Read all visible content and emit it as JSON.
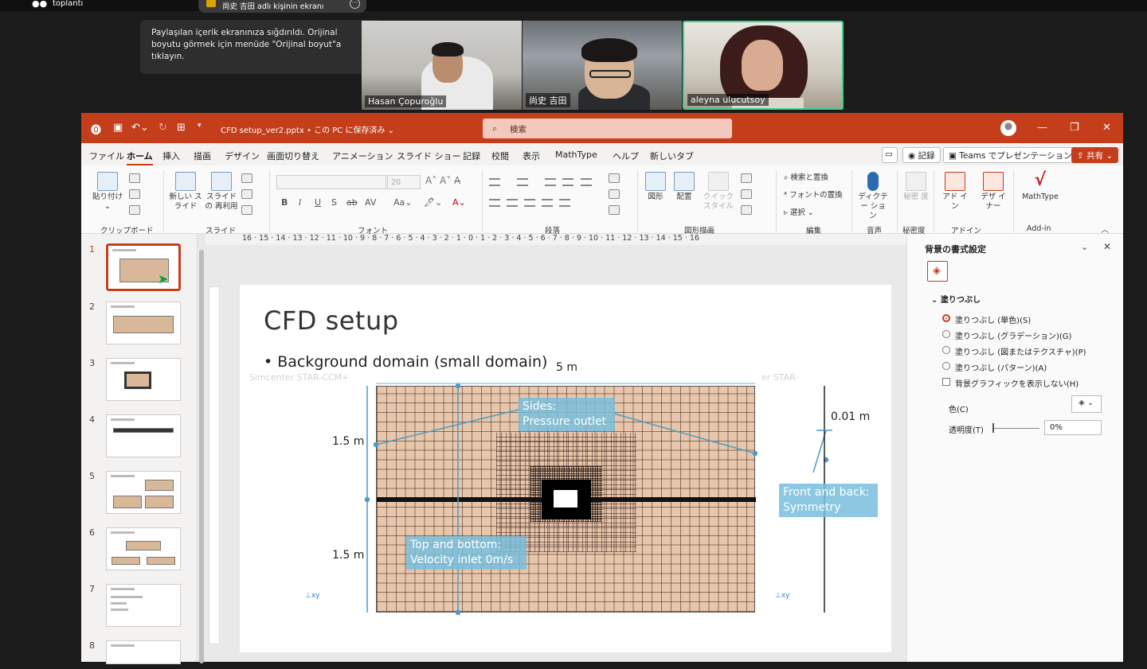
{
  "meeting": {
    "label": "toplantı",
    "sharer_chip": "尚史 吉田 adlı kişinin ekranı",
    "tooltip": "Paylaşılan içerik ekranınıza sığdırıldı. Orijinal boyutu görmek için menüde \"Orijinal boyut\"a tıklayın.",
    "participants": [
      {
        "name": "Hasan Çopuroğlu"
      },
      {
        "name": "尚史 吉田"
      },
      {
        "name": "aleyna ulucutsoy"
      }
    ]
  },
  "powerpoint": {
    "filename": "CFD setup_ver2.pptx • この PC に保存済み ⌄",
    "search_placeholder": "検索",
    "menu": [
      "ファイル",
      "ホーム",
      "挿入",
      "描画",
      "デザイン",
      "画面切り替え",
      "アニメーション",
      "スライド ショー",
      "記録",
      "校閲",
      "表示",
      "MathType",
      "ヘルプ",
      "新しいタブ"
    ],
    "record_btn": "記録",
    "teams_btn": "Teams でプレゼンテーション",
    "share_btn": "共有",
    "ribbon": {
      "paste": "貼り付け",
      "new_slide": "新しい スライド",
      "reuse": "スライドの 再利用",
      "font_size": "20",
      "shapes": "図形",
      "arrange": "配置",
      "quick_styles": "クイック スタイル",
      "find_replace": "検索と置換",
      "font_replace": "フォントの置換",
      "select": "選択",
      "dictate": "ディクテー ション",
      "sensitivity": "秘密 度",
      "addins": "アド イン",
      "designer": "デザ イナー",
      "mathtype": "MathType",
      "groups": [
        "クリップボード",
        "スライド",
        "フォント",
        "段落",
        "図形描画",
        "編集",
        "音声",
        "秘密度",
        "アドイン",
        "Add-in"
      ]
    },
    "ruler_h": "16 · 15 · 14 · 13 · 12 · 11 · 10 · 9 · 8 · 7 · 6 · 5 · 4 · 3 · 2 · 1 · 0 · 1 · 2 · 3 · 4 · 5 · 6 · 7 · 8 · 9 · 10 · 11 · 12 · 13 · 14 · 15 · 16",
    "thumbs": [
      "1",
      "2",
      "3",
      "4",
      "5",
      "6",
      "7",
      "8"
    ],
    "slide": {
      "title": "CFD setup",
      "bullet": "• Background domain (small domain)",
      "watermark_left": "Simcenter STAR-CCM+",
      "watermark_right": "er STAR-",
      "dim_width": "5 m",
      "dim_h1": "1.5 m",
      "dim_h2": "1.5 m",
      "dim_thickness": "0.01 m",
      "callout_sides": "Sides:\nPressure outlet",
      "callout_topbottom": "Top and bottom:\nVelocity inlet 0m/s",
      "callout_frontback": "Front and back:\nSymmetry"
    },
    "format_pane": {
      "title": "背景の書式設定",
      "section": "塗りつぶし",
      "options": [
        "塗りつぶし (単色)(S)",
        "塗りつぶし (グラデーション)(G)",
        "塗りつぶし (図またはテクスチャ)(P)",
        "塗りつぶし (パターン)(A)"
      ],
      "hide_bg": "背景グラフィックを表示しない(H)",
      "color_label": "色(C)",
      "transparency_label": "透明度(T)",
      "transparency_value": "0%"
    }
  }
}
